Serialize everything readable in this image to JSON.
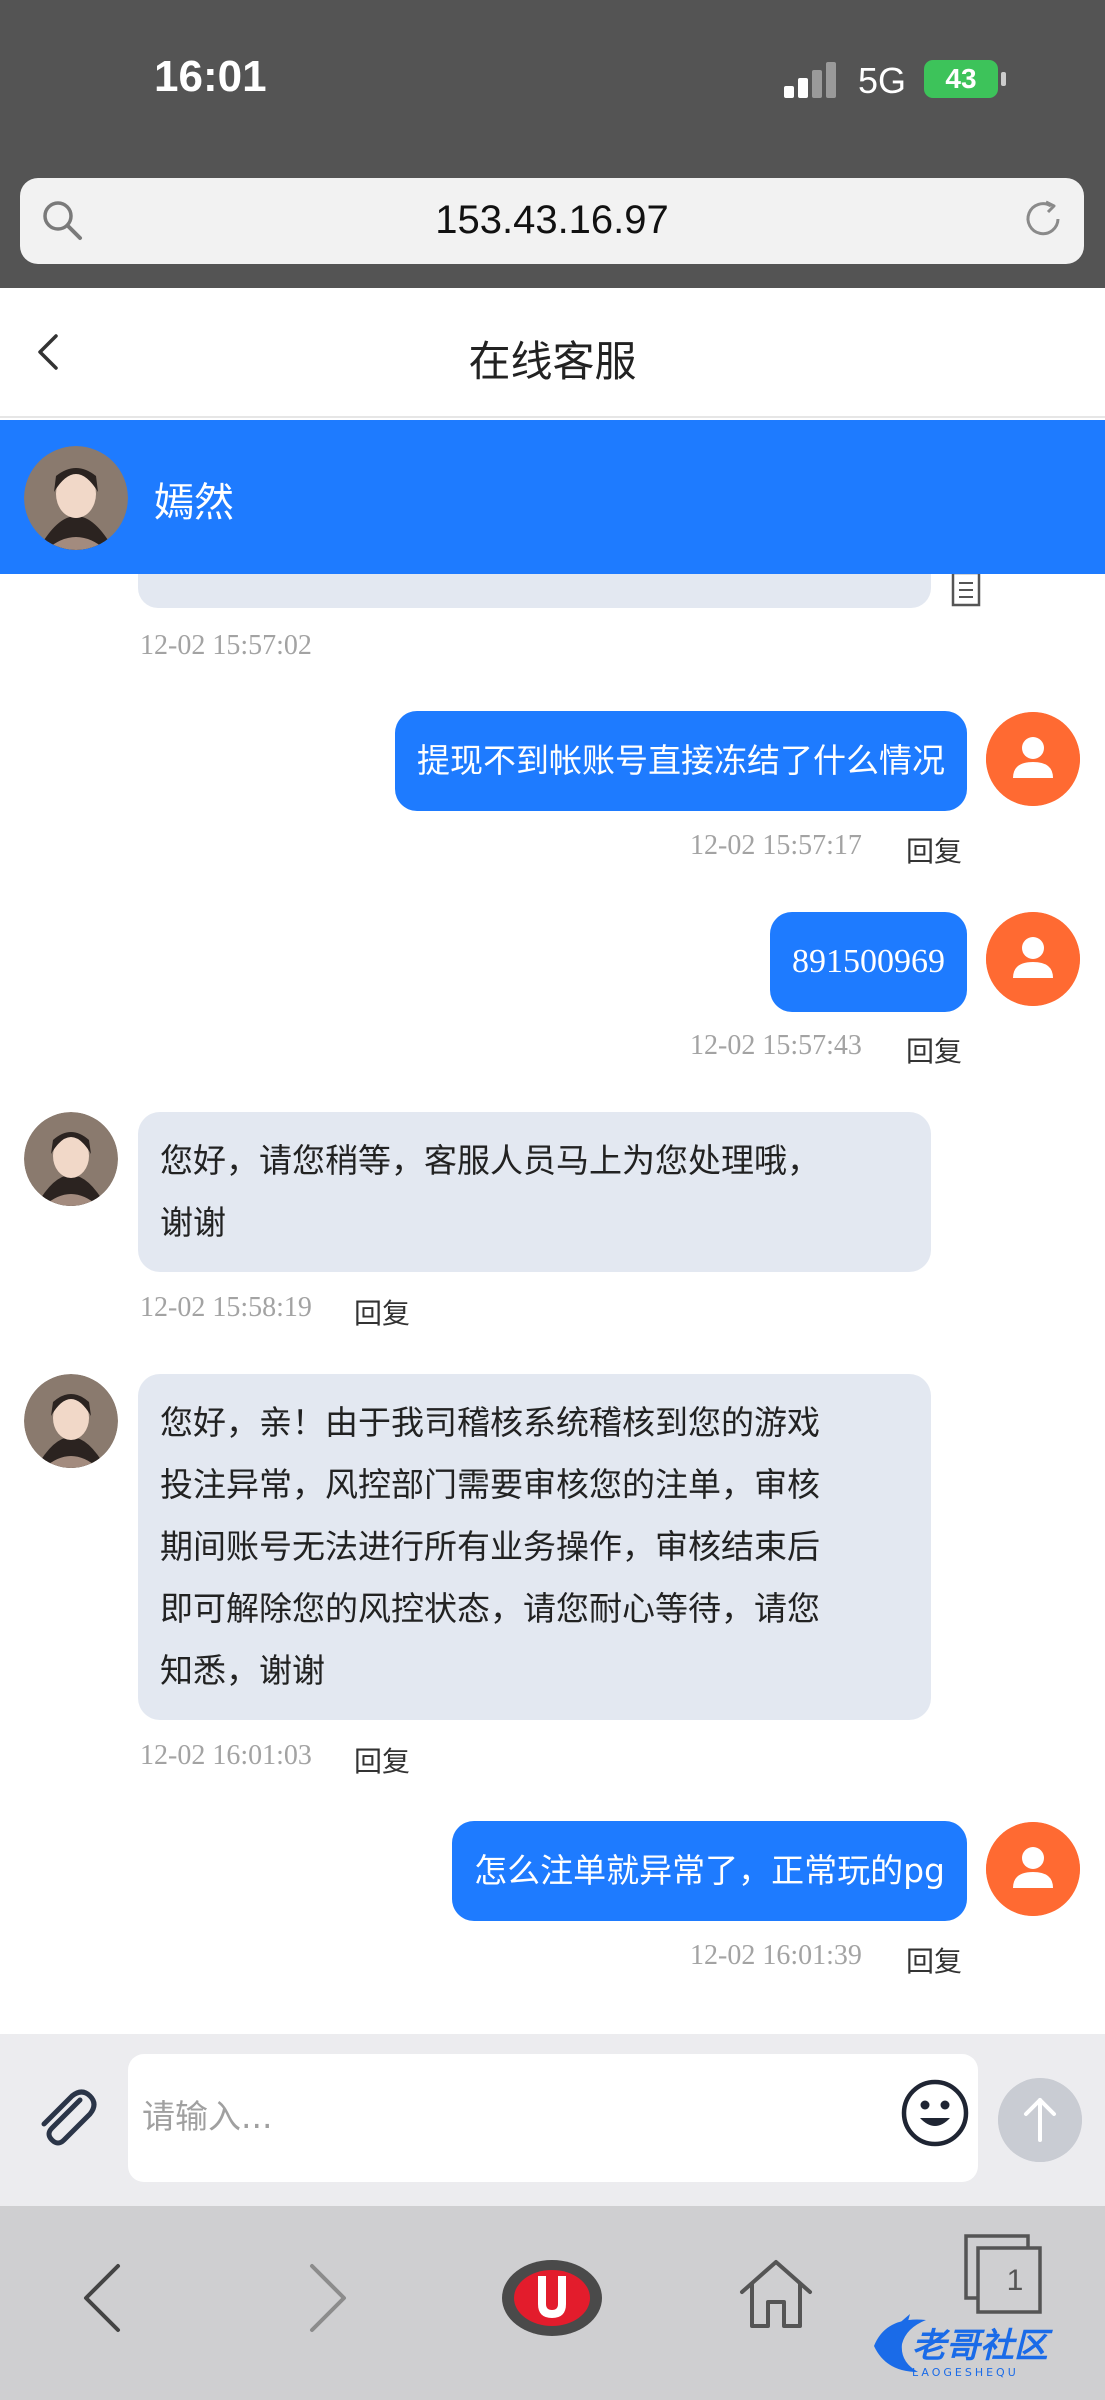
{
  "status_bar": {
    "time": "16:01",
    "network": "5G",
    "battery": "43"
  },
  "browser": {
    "url": "153.43.16.97",
    "tab_count": "1"
  },
  "header": {
    "title": "在线客服"
  },
  "agent": {
    "name": "嫣然"
  },
  "messages": [
    {
      "side": "in",
      "text": "",
      "timestamp": "12-02 15:57:02"
    },
    {
      "side": "out",
      "text": "提现不到帐账号直接冻结了什么情况",
      "timestamp": "12-02 15:57:17",
      "reply": "回复"
    },
    {
      "side": "out",
      "text": "891500969",
      "timestamp": "12-02 15:57:43",
      "reply": "回复"
    },
    {
      "side": "in",
      "lines": [
        "您好，请您稍等，客服人员马上为您处理哦，",
        "谢谢"
      ],
      "timestamp": "12-02 15:58:19",
      "reply": "回复"
    },
    {
      "side": "in",
      "lines": [
        "您好，亲！由于我司稽核系统稽核到您的游戏",
        "投注异常，风控部门需要审核您的注单，审核",
        "期间账号无法进行所有业务操作，审核结束后",
        "即可解除您的风控状态，请您耐心等待，请您",
        "知悉，谢谢"
      ],
      "timestamp": "12-02 16:01:03",
      "reply": "回复"
    },
    {
      "side": "out",
      "text": "怎么注单就异常了，正常玩的pg",
      "timestamp": "12-02 16:01:39",
      "reply": "回复"
    }
  ],
  "input": {
    "placeholder": "请输入..."
  },
  "watermark": {
    "text": "老哥社区",
    "sub": "LAOGESHEQU"
  },
  "colors": {
    "accent_blue": "#1e7bff",
    "user_avatar": "#ff6a32",
    "incoming_bubble": "#e3e8f1"
  }
}
